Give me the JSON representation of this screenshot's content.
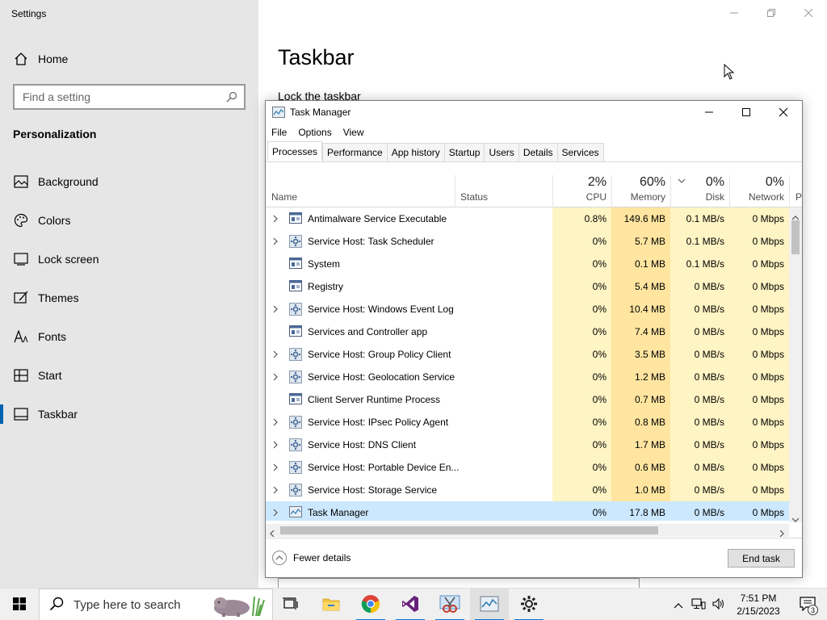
{
  "settings": {
    "window_title": "Settings",
    "home_label": "Home",
    "search_placeholder": "Find a setting",
    "section_heading": "Personalization",
    "nav_items": [
      {
        "label": "Background"
      },
      {
        "label": "Colors"
      },
      {
        "label": "Lock screen"
      },
      {
        "label": "Themes"
      },
      {
        "label": "Fonts"
      },
      {
        "label": "Start"
      },
      {
        "label": "Taskbar"
      }
    ],
    "page_title": "Taskbar",
    "lock_taskbar_label": "Lock the taskbar"
  },
  "task_manager": {
    "title": "Task Manager",
    "menu": [
      "File",
      "Options",
      "View"
    ],
    "tabs": [
      "Processes",
      "Performance",
      "App history",
      "Startup",
      "Users",
      "Details",
      "Services"
    ],
    "columns": {
      "name": "Name",
      "status": "Status",
      "cpu_pct": "2%",
      "cpu": "CPU",
      "mem_pct": "60%",
      "mem": "Memory",
      "disk_pct": "0%",
      "disk": "Disk",
      "net_pct": "0%",
      "net": "Network",
      "power_trunc": "P"
    },
    "processes": [
      {
        "name": "Antimalware Service Executable",
        "cpu": "0.8%",
        "mem": "149.6 MB",
        "disk": "0.1 MB/s",
        "net": "0 Mbps",
        "expand": true,
        "icon": "window-icon"
      },
      {
        "name": "Service Host: Task Scheduler",
        "cpu": "0%",
        "mem": "5.7 MB",
        "disk": "0.1 MB/s",
        "net": "0 Mbps",
        "expand": true,
        "icon": "gear-icon"
      },
      {
        "name": "System",
        "cpu": "0%",
        "mem": "0.1 MB",
        "disk": "0.1 MB/s",
        "net": "0 Mbps",
        "expand": false,
        "icon": "window-icon"
      },
      {
        "name": "Registry",
        "cpu": "0%",
        "mem": "5.4 MB",
        "disk": "0 MB/s",
        "net": "0 Mbps",
        "expand": false,
        "icon": "window-icon"
      },
      {
        "name": "Service Host: Windows Event Log",
        "cpu": "0%",
        "mem": "10.4 MB",
        "disk": "0 MB/s",
        "net": "0 Mbps",
        "expand": true,
        "icon": "gear-icon"
      },
      {
        "name": "Services and Controller app",
        "cpu": "0%",
        "mem": "7.4 MB",
        "disk": "0 MB/s",
        "net": "0 Mbps",
        "expand": false,
        "icon": "window-icon"
      },
      {
        "name": "Service Host: Group Policy Client",
        "cpu": "0%",
        "mem": "3.5 MB",
        "disk": "0 MB/s",
        "net": "0 Mbps",
        "expand": true,
        "icon": "gear-icon"
      },
      {
        "name": "Service Host: Geolocation Service",
        "cpu": "0%",
        "mem": "1.2 MB",
        "disk": "0 MB/s",
        "net": "0 Mbps",
        "expand": true,
        "icon": "gear-icon"
      },
      {
        "name": "Client Server Runtime Process",
        "cpu": "0%",
        "mem": "0.7 MB",
        "disk": "0 MB/s",
        "net": "0 Mbps",
        "expand": false,
        "icon": "window-icon"
      },
      {
        "name": "Service Host: IPsec Policy Agent",
        "cpu": "0%",
        "mem": "0.8 MB",
        "disk": "0 MB/s",
        "net": "0 Mbps",
        "expand": true,
        "icon": "gear-icon"
      },
      {
        "name": "Service Host: DNS Client",
        "cpu": "0%",
        "mem": "1.7 MB",
        "disk": "0 MB/s",
        "net": "0 Mbps",
        "expand": true,
        "icon": "gear-icon"
      },
      {
        "name": "Service Host: Portable Device En...",
        "cpu": "0%",
        "mem": "0.6 MB",
        "disk": "0 MB/s",
        "net": "0 Mbps",
        "expand": true,
        "icon": "gear-icon"
      },
      {
        "name": "Service Host: Storage Service",
        "cpu": "0%",
        "mem": "1.0 MB",
        "disk": "0 MB/s",
        "net": "0 Mbps",
        "expand": true,
        "icon": "gear-icon"
      },
      {
        "name": "Task Manager",
        "cpu": "0%",
        "mem": "17.8 MB",
        "disk": "0 MB/s",
        "net": "0 Mbps",
        "expand": true,
        "icon": "task-manager-icon",
        "selected": true
      }
    ],
    "fewer_details": "Fewer details",
    "end_task": "End task"
  },
  "taskbar": {
    "search_placeholder": "Type here to search",
    "apps": [
      "task-view-icon",
      "file-explorer-icon",
      "chrome-icon",
      "visual-studio-icon",
      "snipping-tool-icon",
      "task-manager-icon",
      "settings-icon"
    ],
    "time": "7:51 PM",
    "date": "2/15/2023",
    "notification_count": "3"
  }
}
